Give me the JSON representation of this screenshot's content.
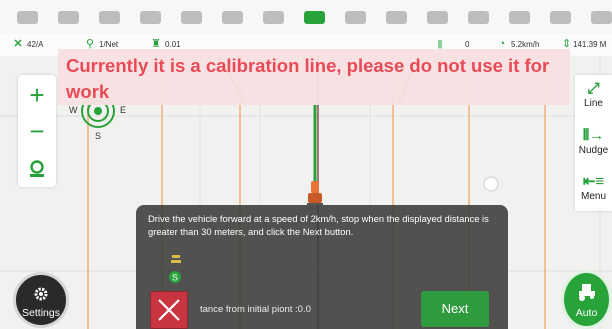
{
  "pager": {
    "count": 15,
    "active_index": 7
  },
  "status": {
    "satellites": "42/A",
    "accuracy": "1/Net",
    "tilt": "0.01",
    "heading": "0",
    "speed": "5.2km/h",
    "area": "141.39 M"
  },
  "banner": {
    "text": "Currently it is a calibration line, please do not use it for work"
  },
  "compass": {
    "west": "W",
    "east": "E",
    "south": "S"
  },
  "zoom": {
    "in_label": "+",
    "out_label": "−"
  },
  "right_panel": {
    "line_label": "Line",
    "nudge_label": "Nudge",
    "menu_label": "Menu"
  },
  "dialog": {
    "instruction": "Drive the vehicle forward at a speed of 2km/h, stop when the displayed distance is greater than 30 meters, and click the Next button.",
    "distance_text": "tance from initial piont :0.0",
    "next_label": "Next"
  },
  "settings_label": "Settings",
  "auto_label": "Auto",
  "colors": {
    "accent_green": "#27a33a",
    "warning_red": "#e84a56",
    "close_red": "#c8343f",
    "guide_orange": "#f3b07c"
  }
}
